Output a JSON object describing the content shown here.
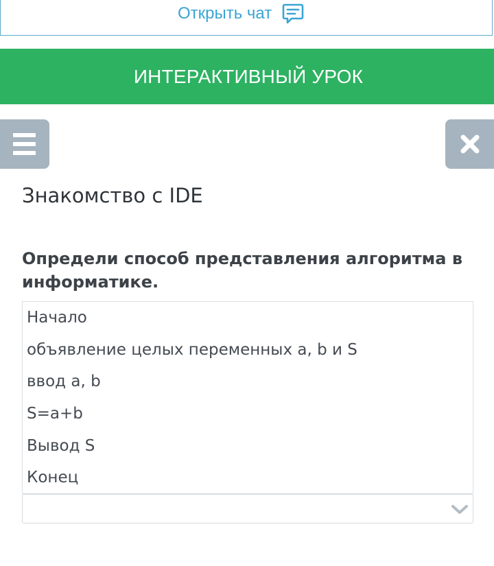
{
  "chat": {
    "open_chat_label": "Открыть чат",
    "icon": "chat-bubble-icon",
    "accent_color": "#3aa4d4"
  },
  "banner": {
    "title": "ИНТЕРАКТИВНЫЙ УРОК",
    "color": "#2db262"
  },
  "controls": {
    "menu_icon": "hamburger-menu-icon",
    "close_icon": "close-icon",
    "button_color": "#a6b4bf"
  },
  "lesson": {
    "title": "Знакомство с IDE"
  },
  "task": {
    "question": "Определи способ представления алгоритма в информатике.",
    "algorithm_lines": [
      "Начало",
      "объявление целых переменных a, b и S",
      "ввод a, b",
      "S=a+b",
      "Вывод S",
      "Конец"
    ],
    "answer": {
      "selected_value": "",
      "icon": "chevron-down-icon"
    }
  }
}
